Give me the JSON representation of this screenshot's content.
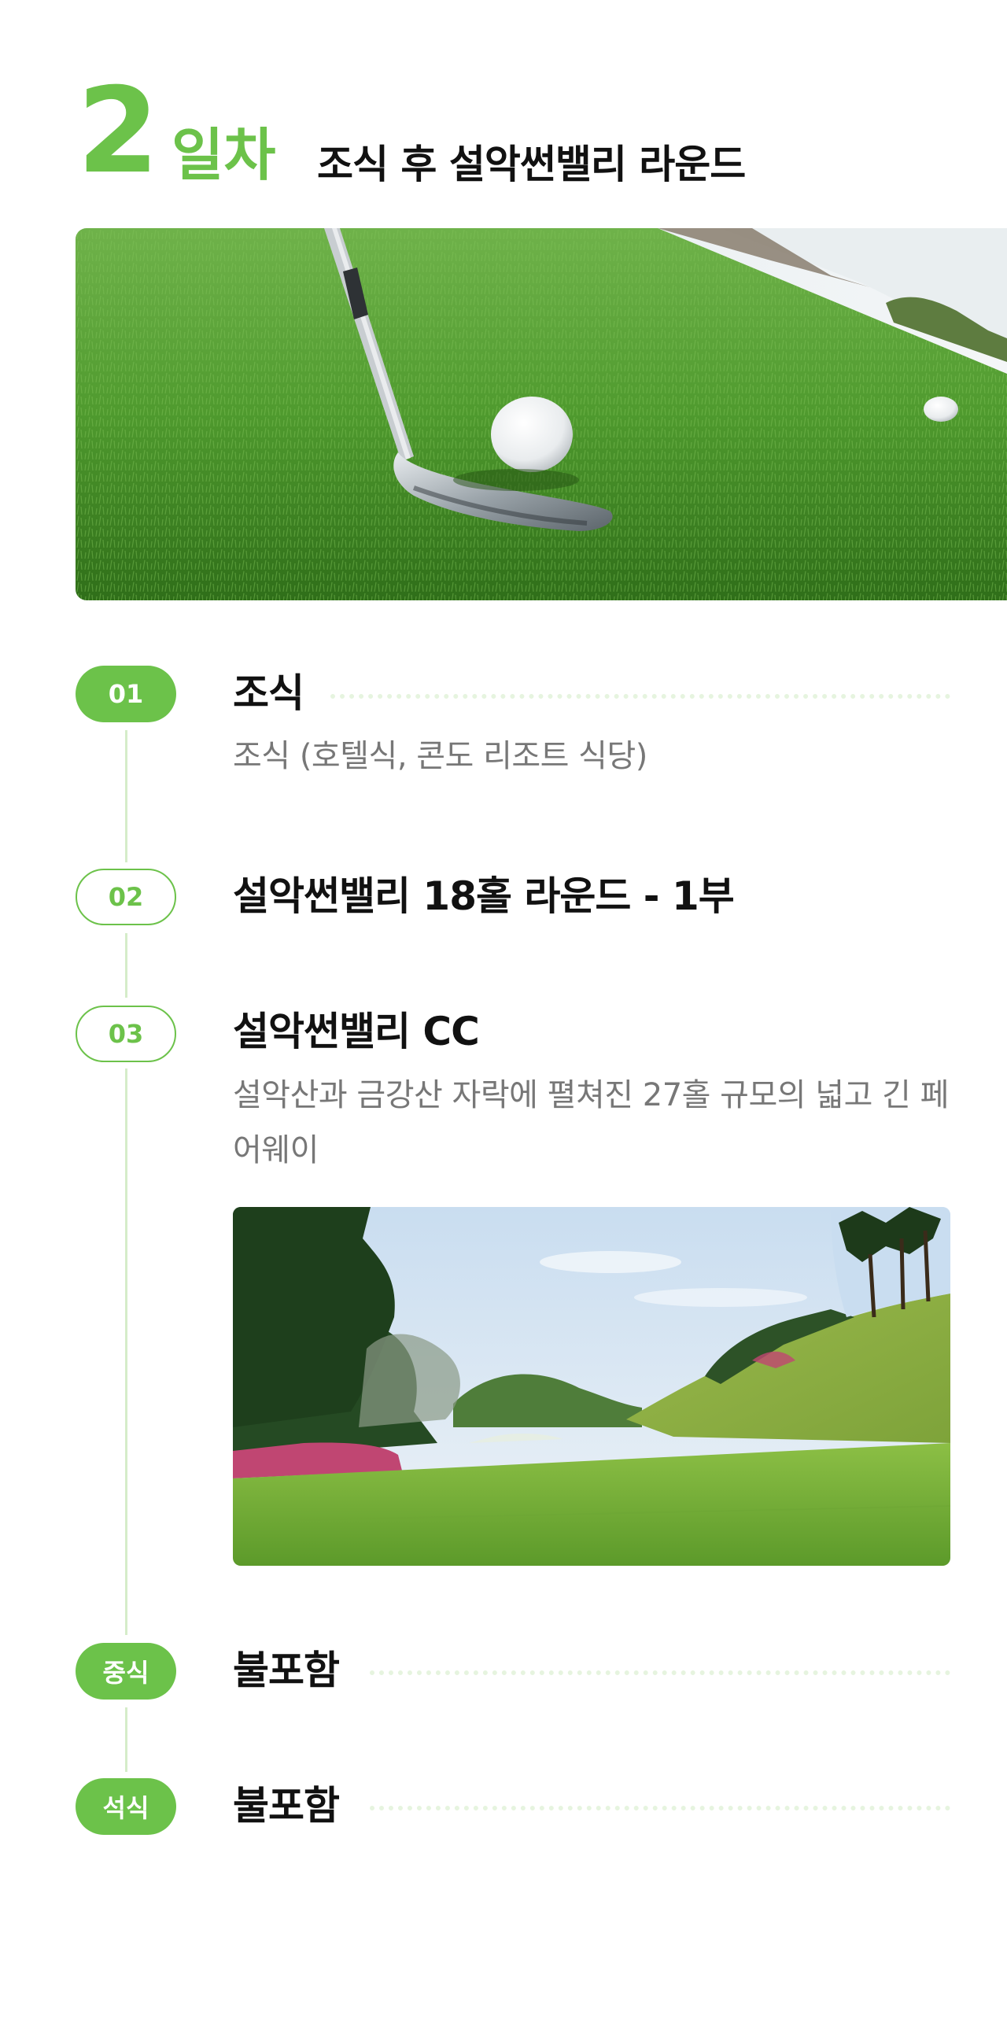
{
  "day": {
    "number": "2",
    "suffix": "일차",
    "title": "조식 후 설악썬밸리 라운드"
  },
  "schedule": [
    {
      "badge": "01",
      "title": "조식",
      "desc": "조식 (호텔식, 콘도 리조트 식당)"
    },
    {
      "badge": "02",
      "title": "설악썬밸리 18홀 라운드 - 1부"
    },
    {
      "badge": "03",
      "title": "설악썬밸리 CC",
      "desc": "설악산과 금강산 자락에 펼쳐진 27홀 규모의 넓고 긴 페어웨이"
    },
    {
      "badge": "중식",
      "title": "불포함"
    },
    {
      "badge": "석식",
      "title": "불포함"
    }
  ],
  "colors": {
    "accent": "#6cc24a",
    "timeline": "#d5ecc9",
    "dots": "#e6f4df",
    "desc_text": "#777777"
  },
  "icons": {
    "hero": "golf-club-ball-image",
    "course": "golf-course-fairway-image"
  }
}
